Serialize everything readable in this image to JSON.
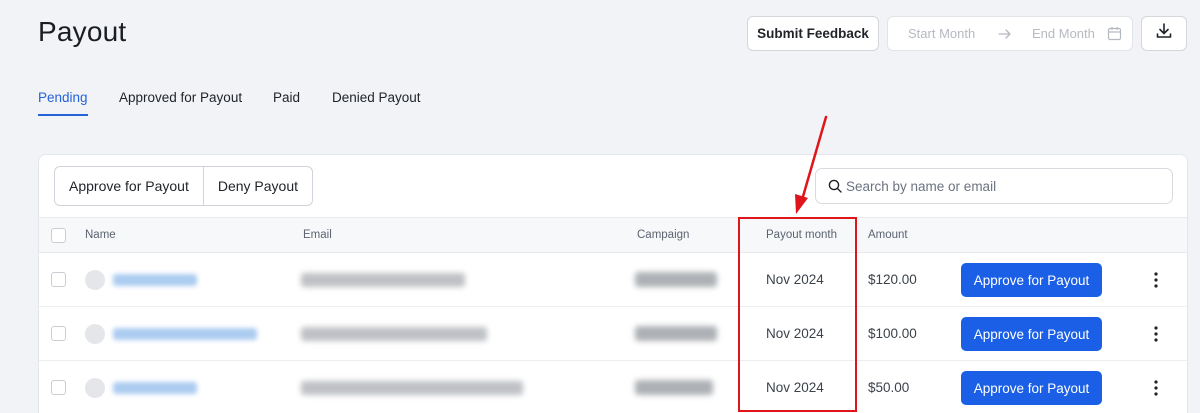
{
  "page": {
    "title": "Payout"
  },
  "header": {
    "feedback_label": "Submit Feedback",
    "start_month_placeholder": "Start Month",
    "end_month_placeholder": "End Month"
  },
  "tabs": [
    {
      "label": "Pending",
      "active": true
    },
    {
      "label": "Approved for Payout",
      "active": false
    },
    {
      "label": "Paid",
      "active": false
    },
    {
      "label": "Denied Payout",
      "active": false
    }
  ],
  "toolbar": {
    "approve_label": "Approve for Payout",
    "deny_label": "Deny Payout",
    "search_placeholder": "Search by name or email"
  },
  "table": {
    "columns": [
      "Name",
      "Email",
      "Campaign",
      "Payout month",
      "Amount"
    ],
    "rows": [
      {
        "payout_month": "Nov 2024",
        "amount": "$120.00",
        "action_label": "Approve for Payout"
      },
      {
        "payout_month": "Nov 2024",
        "amount": "$100.00",
        "action_label": "Approve for Payout"
      },
      {
        "payout_month": "Nov 2024",
        "amount": "$50.00",
        "action_label": "Approve for Payout"
      }
    ]
  },
  "colors": {
    "accent": "#2563d9",
    "primary_button": "#1a5fe6",
    "annotation": "#e0151b"
  }
}
